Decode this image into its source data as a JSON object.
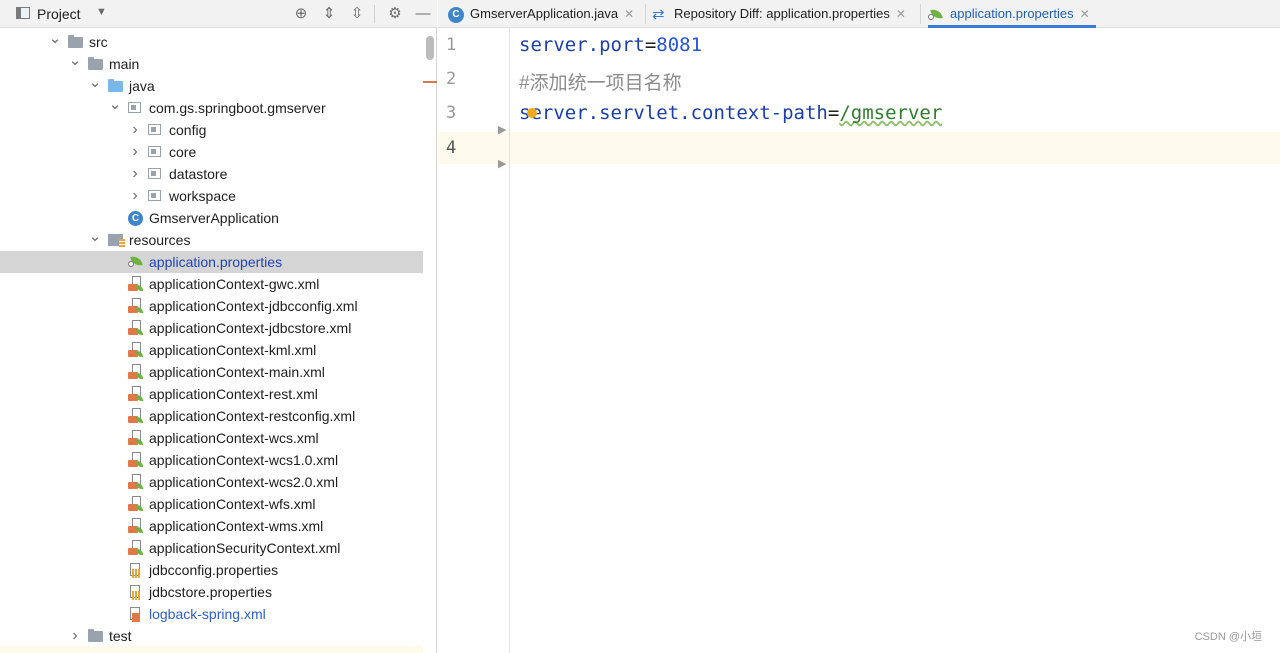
{
  "project_panel": {
    "title": "Project",
    "header_icons": [
      "crosshair-icon",
      "expand-all-icon",
      "collapse-all-icon",
      "gear-icon",
      "minimize-icon"
    ]
  },
  "tree": [
    {
      "label": "src",
      "icon": "folder",
      "chevron": "open"
    },
    {
      "label": "main",
      "icon": "folder",
      "chevron": "open"
    },
    {
      "label": "java",
      "icon": "folder-blue",
      "chevron": "open"
    },
    {
      "label": "com.gs.springboot.gmserver",
      "icon": "package",
      "chevron": "open"
    },
    {
      "label": "config",
      "icon": "package",
      "chevron": "closed"
    },
    {
      "label": "core",
      "icon": "package",
      "chevron": "closed"
    },
    {
      "label": "datastore",
      "icon": "package",
      "chevron": "closed"
    },
    {
      "label": "workspace",
      "icon": "package",
      "chevron": "closed"
    },
    {
      "label": "GmserverApplication",
      "icon": "java-class",
      "chevron": "none"
    },
    {
      "label": "resources",
      "icon": "resources-folder",
      "chevron": "open"
    },
    {
      "label": "application.properties",
      "icon": "spring-properties",
      "chevron": "none",
      "selected": true,
      "color": "#2244bb"
    },
    {
      "label": "applicationContext-gwc.xml",
      "icon": "spring-xml",
      "chevron": "none"
    },
    {
      "label": "applicationContext-jdbcconfig.xml",
      "icon": "spring-xml",
      "chevron": "none"
    },
    {
      "label": "applicationContext-jdbcstore.xml",
      "icon": "spring-xml",
      "chevron": "none"
    },
    {
      "label": "applicationContext-kml.xml",
      "icon": "spring-xml",
      "chevron": "none"
    },
    {
      "label": "applicationContext-main.xml",
      "icon": "spring-xml",
      "chevron": "none"
    },
    {
      "label": "applicationContext-rest.xml",
      "icon": "spring-xml",
      "chevron": "none"
    },
    {
      "label": "applicationContext-restconfig.xml",
      "icon": "spring-xml",
      "chevron": "none"
    },
    {
      "label": "applicationContext-wcs.xml",
      "icon": "spring-xml",
      "chevron": "none"
    },
    {
      "label": "applicationContext-wcs1.0.xml",
      "icon": "spring-xml",
      "chevron": "none"
    },
    {
      "label": "applicationContext-wcs2.0.xml",
      "icon": "spring-xml",
      "chevron": "none"
    },
    {
      "label": "applicationContext-wfs.xml",
      "icon": "spring-xml",
      "chevron": "none"
    },
    {
      "label": "applicationContext-wms.xml",
      "icon": "spring-xml",
      "chevron": "none"
    },
    {
      "label": "applicationSecurityContext.xml",
      "icon": "spring-xml",
      "chevron": "none"
    },
    {
      "label": "jdbcconfig.properties",
      "icon": "properties",
      "chevron": "none"
    },
    {
      "label": "jdbcstore.properties",
      "icon": "properties",
      "chevron": "none"
    },
    {
      "label": "logback-spring.xml",
      "icon": "xml",
      "chevron": "none",
      "color": "#2b5fca"
    },
    {
      "label": "test",
      "icon": "folder",
      "chevron": "closed"
    }
  ],
  "tabs": [
    {
      "label": "GmserverApplication.java",
      "icon": "java-class-icon",
      "active": false
    },
    {
      "label": "Repository Diff: application.properties",
      "icon": "diff-icon",
      "active": false
    },
    {
      "label": "application.properties",
      "icon": "spring-properties-icon",
      "active": true
    }
  ],
  "editor": {
    "line_numbers": [
      "1",
      "2",
      "3",
      "4"
    ],
    "current_line": "4",
    "lines": [
      {
        "key": "server.port",
        "sep": "=",
        "value": "8081"
      },
      {
        "comment": "#添加统一项目名称"
      },
      {
        "key": "server.servlet.context-path",
        "sep": "=",
        "value": "/gmserver"
      },
      {}
    ]
  },
  "watermark": "CSDN @小垣",
  "colors": {
    "selection": "#d5d5d5",
    "active_tab_underline": "#3a7bd5",
    "current_line": "#fcfbec"
  }
}
